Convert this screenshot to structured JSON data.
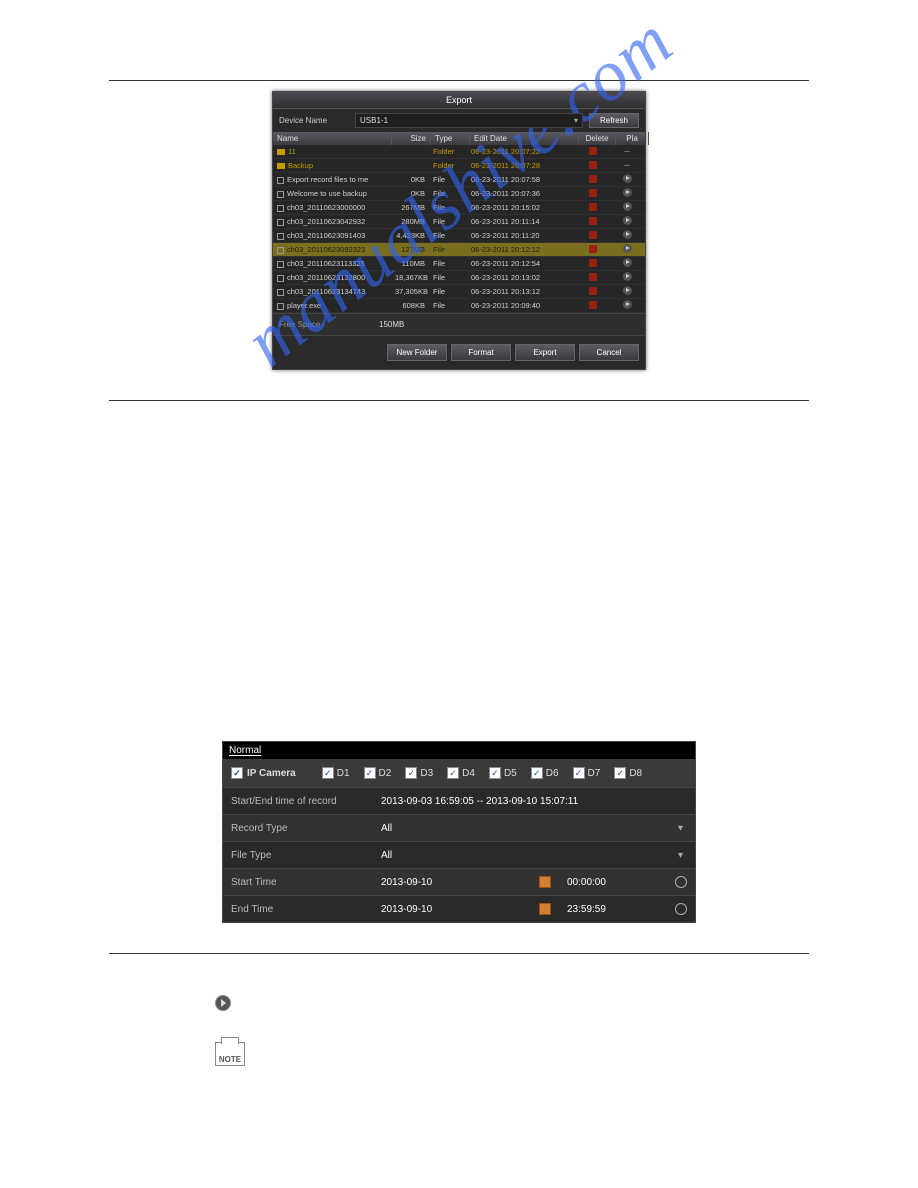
{
  "watermark": "manualshive.com",
  "note_label": "NOTE",
  "export": {
    "title": "Export",
    "device_label": "Device Name",
    "device_value": "USB1-1",
    "refresh": "Refresh",
    "cols": {
      "name": "Name",
      "size": "Size",
      "type": "Type",
      "edit": "Edit Date",
      "del": "Delete",
      "play": "Pla"
    },
    "free_label": "Free Space",
    "free_value": "150MB",
    "buttons": {
      "newfolder": "New Folder",
      "format": "Format",
      "export": "Export",
      "cancel": "Cancel"
    },
    "files": [
      {
        "folder": true,
        "name": "11",
        "size": "",
        "type": "Folder",
        "edit": "06-23-2011 20:07:22",
        "del": true,
        "play": "dash"
      },
      {
        "folder": true,
        "name": "Backup",
        "size": "",
        "type": "Folder",
        "edit": "06-23-2011 20:07:28",
        "del": true,
        "play": "dash"
      },
      {
        "folder": false,
        "name": "Export record files to me",
        "size": "0KB",
        "type": "File",
        "edit": "06-23-2011 20:07:58",
        "del": true,
        "play": "play"
      },
      {
        "folder": false,
        "name": "Welcome to use backup",
        "size": "0KB",
        "type": "File",
        "edit": "06-23-2011 20:07:36",
        "del": true,
        "play": "play"
      },
      {
        "folder": false,
        "name": "ch03_20110623000000",
        "size": "267MB",
        "type": "File",
        "edit": "06-23-2011 20:15:02",
        "del": true,
        "play": "play"
      },
      {
        "folder": false,
        "name": "ch03_20110623042932",
        "size": "280MB",
        "type": "File",
        "edit": "06-23-2011 20:11:14",
        "del": true,
        "play": "play"
      },
      {
        "folder": false,
        "name": "ch03_20110623091403",
        "size": "4,423KB",
        "type": "File",
        "edit": "06-23-2011 20:11:20",
        "del": true,
        "play": "play"
      },
      {
        "folder": false,
        "name": "ch03_20110623092323",
        "size": "127MB",
        "type": "File",
        "edit": "06-23-2011 20:12:12",
        "del": true,
        "play": "play",
        "hl": true
      },
      {
        "folder": false,
        "name": "ch03_20110623113325",
        "size": "110MB",
        "type": "File",
        "edit": "06-23-2011 20:12:54",
        "del": true,
        "play": "play"
      },
      {
        "folder": false,
        "name": "ch03_20110623132800",
        "size": "18,367KB",
        "type": "File",
        "edit": "06-23-2011 20:13:02",
        "del": true,
        "play": "play"
      },
      {
        "folder": false,
        "name": "ch03_20110623134743",
        "size": "37,305KB",
        "type": "File",
        "edit": "06-23-2011 20:13:12",
        "del": true,
        "play": "play"
      },
      {
        "folder": false,
        "name": "player.exe",
        "size": "608KB",
        "type": "File",
        "edit": "06-23-2011 20:09:40",
        "del": true,
        "play": "play"
      }
    ]
  },
  "normal": {
    "title": "Normal",
    "ipc": "IP Camera",
    "cams": [
      "D1",
      "D2",
      "D3",
      "D4",
      "D5",
      "D6",
      "D7",
      "D8"
    ],
    "startend_label": "Start/End time of record",
    "startend_value": "2013-09-03 16:59:05 -- 2013-09-10 15:07:11",
    "recordtype_label": "Record Type",
    "recordtype_value": "All",
    "filetype_label": "File Type",
    "filetype_value": "All",
    "starttime_label": "Start Time",
    "start_date": "2013-09-10",
    "start_time": "00:00:00",
    "endtime_label": "End Time",
    "end_date": "2013-09-10",
    "end_time": "23:59:59"
  }
}
